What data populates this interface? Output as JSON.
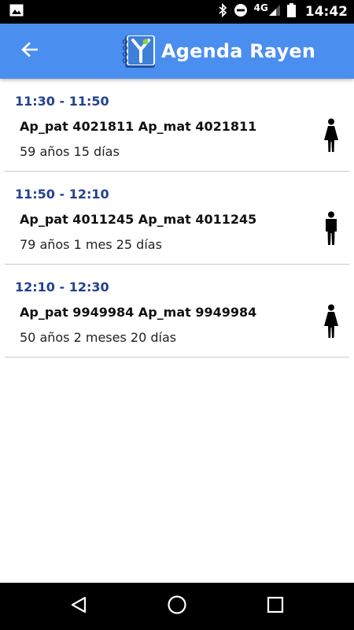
{
  "status_bar": {
    "network": "4G",
    "time": "14:42"
  },
  "app_bar": {
    "title": "Agenda Rayen",
    "color": "#4a8ef0"
  },
  "appointments": [
    {
      "time": "11:30 - 11:50",
      "name": "Ap_pat 4021811 Ap_mat 4021811",
      "age": "59 años 15 días",
      "gender": "female"
    },
    {
      "time": "11:50 - 12:10",
      "name": "Ap_pat 4011245 Ap_mat 4011245",
      "age": "79 años 1 mes 25 días",
      "gender": "male"
    },
    {
      "time": "12:10 - 12:30",
      "name": "Ap_pat 9949984 Ap_mat 9949984",
      "age": "50 años 2 meses 20 días",
      "gender": "female"
    }
  ],
  "colors": {
    "time_text": "#23418f",
    "divider": "#c9c9c9"
  },
  "icons": {
    "back": "arrow-back-icon",
    "female": "female-icon",
    "male": "male-icon",
    "nav_back": "triangle-back-icon",
    "nav_home": "circle-home-icon",
    "nav_recents": "square-recents-icon"
  }
}
